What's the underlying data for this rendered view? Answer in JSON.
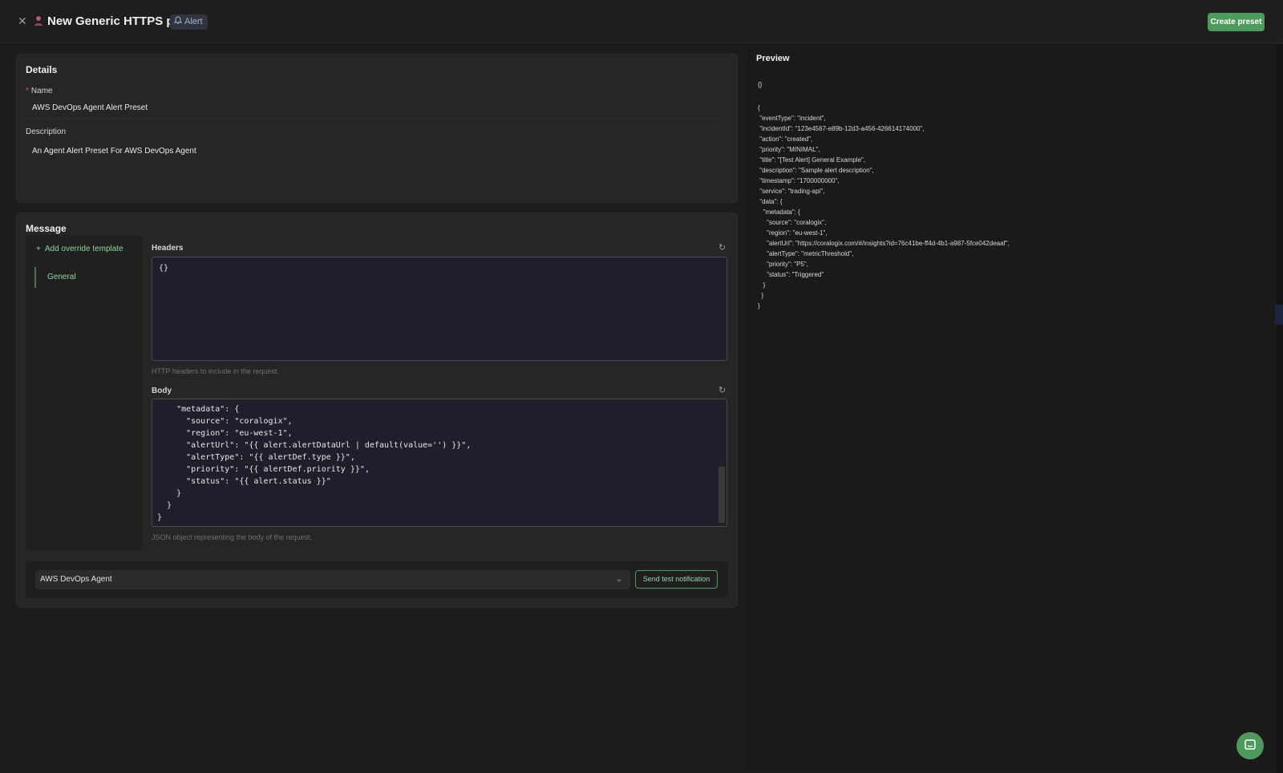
{
  "header": {
    "title": "New Generic HTTPS preset",
    "badge": "Alert",
    "create_label": "Create preset"
  },
  "details": {
    "title": "Details",
    "name_label": "Name",
    "name_value": "AWS DevOps Agent Alert Preset",
    "description_label": "Description",
    "description_value": "An Agent Alert Preset For AWS DevOps Agent"
  },
  "message": {
    "title": "Message",
    "add_template_label": "Add override template",
    "sidebar_items": [
      {
        "label": "General"
      }
    ],
    "headers_label": "Headers",
    "headers_value": "{}",
    "headers_helper": "HTTP headers to include in the request.",
    "body_label": "Body",
    "body_helper": "JSON object representing the body of the request.",
    "body_lines": [
      "    \"metadata\": {",
      "      \"source\": \"coralogix\",",
      "      \"region\": \"eu-west-1\",",
      "      \"alertUrl\": \"{{ alert.alertDataUrl | default(value='') }}\",",
      "      \"alertType\": \"{{ alertDef.type }}\",",
      "      \"priority\": \"{{ alertDef.priority }}\",",
      "      \"status\": \"{{ alert.status }}\"",
      "    }",
      "  }",
      "}"
    ]
  },
  "footer": {
    "integration_value": "AWS DevOps Agent",
    "send_test_label": "Send test notification"
  },
  "preview": {
    "title": "Preview",
    "headers": "{}",
    "lines": [
      "{",
      " \"eventType\": \"incident\",",
      " \"incidentId\": \"123e4567-e89b-12d3-a456-426614174000\",",
      " \"action\": \"created\",",
      " \"priority\": \"MINIMAL\",",
      " \"title\": \"[Test Alert] General Example\",",
      " \"description\": \"Sample alert description\",",
      " \"timestamp\": \"1700000000\",",
      " \"service\": \"trading-api\",",
      " \"data\": {",
      "   \"metadata\": {",
      "     \"source\": \"coralogix\",",
      "     \"region\": \"eu-west-1\",",
      "     \"alertUrl\": \"https://coralogix.com/#/insights?id=76c41be-ff4d-4b1-a987-5fce042deaaf\",",
      "     \"alertType\": \"metricThreshold\",",
      "     \"priority\": \"P5\",",
      "     \"status\": \"Triggered\"",
      "   }",
      "  }",
      "}"
    ]
  },
  "colors": {
    "accent": "#4e9a5c",
    "background": "#1c1c1c",
    "card": "#262626"
  }
}
